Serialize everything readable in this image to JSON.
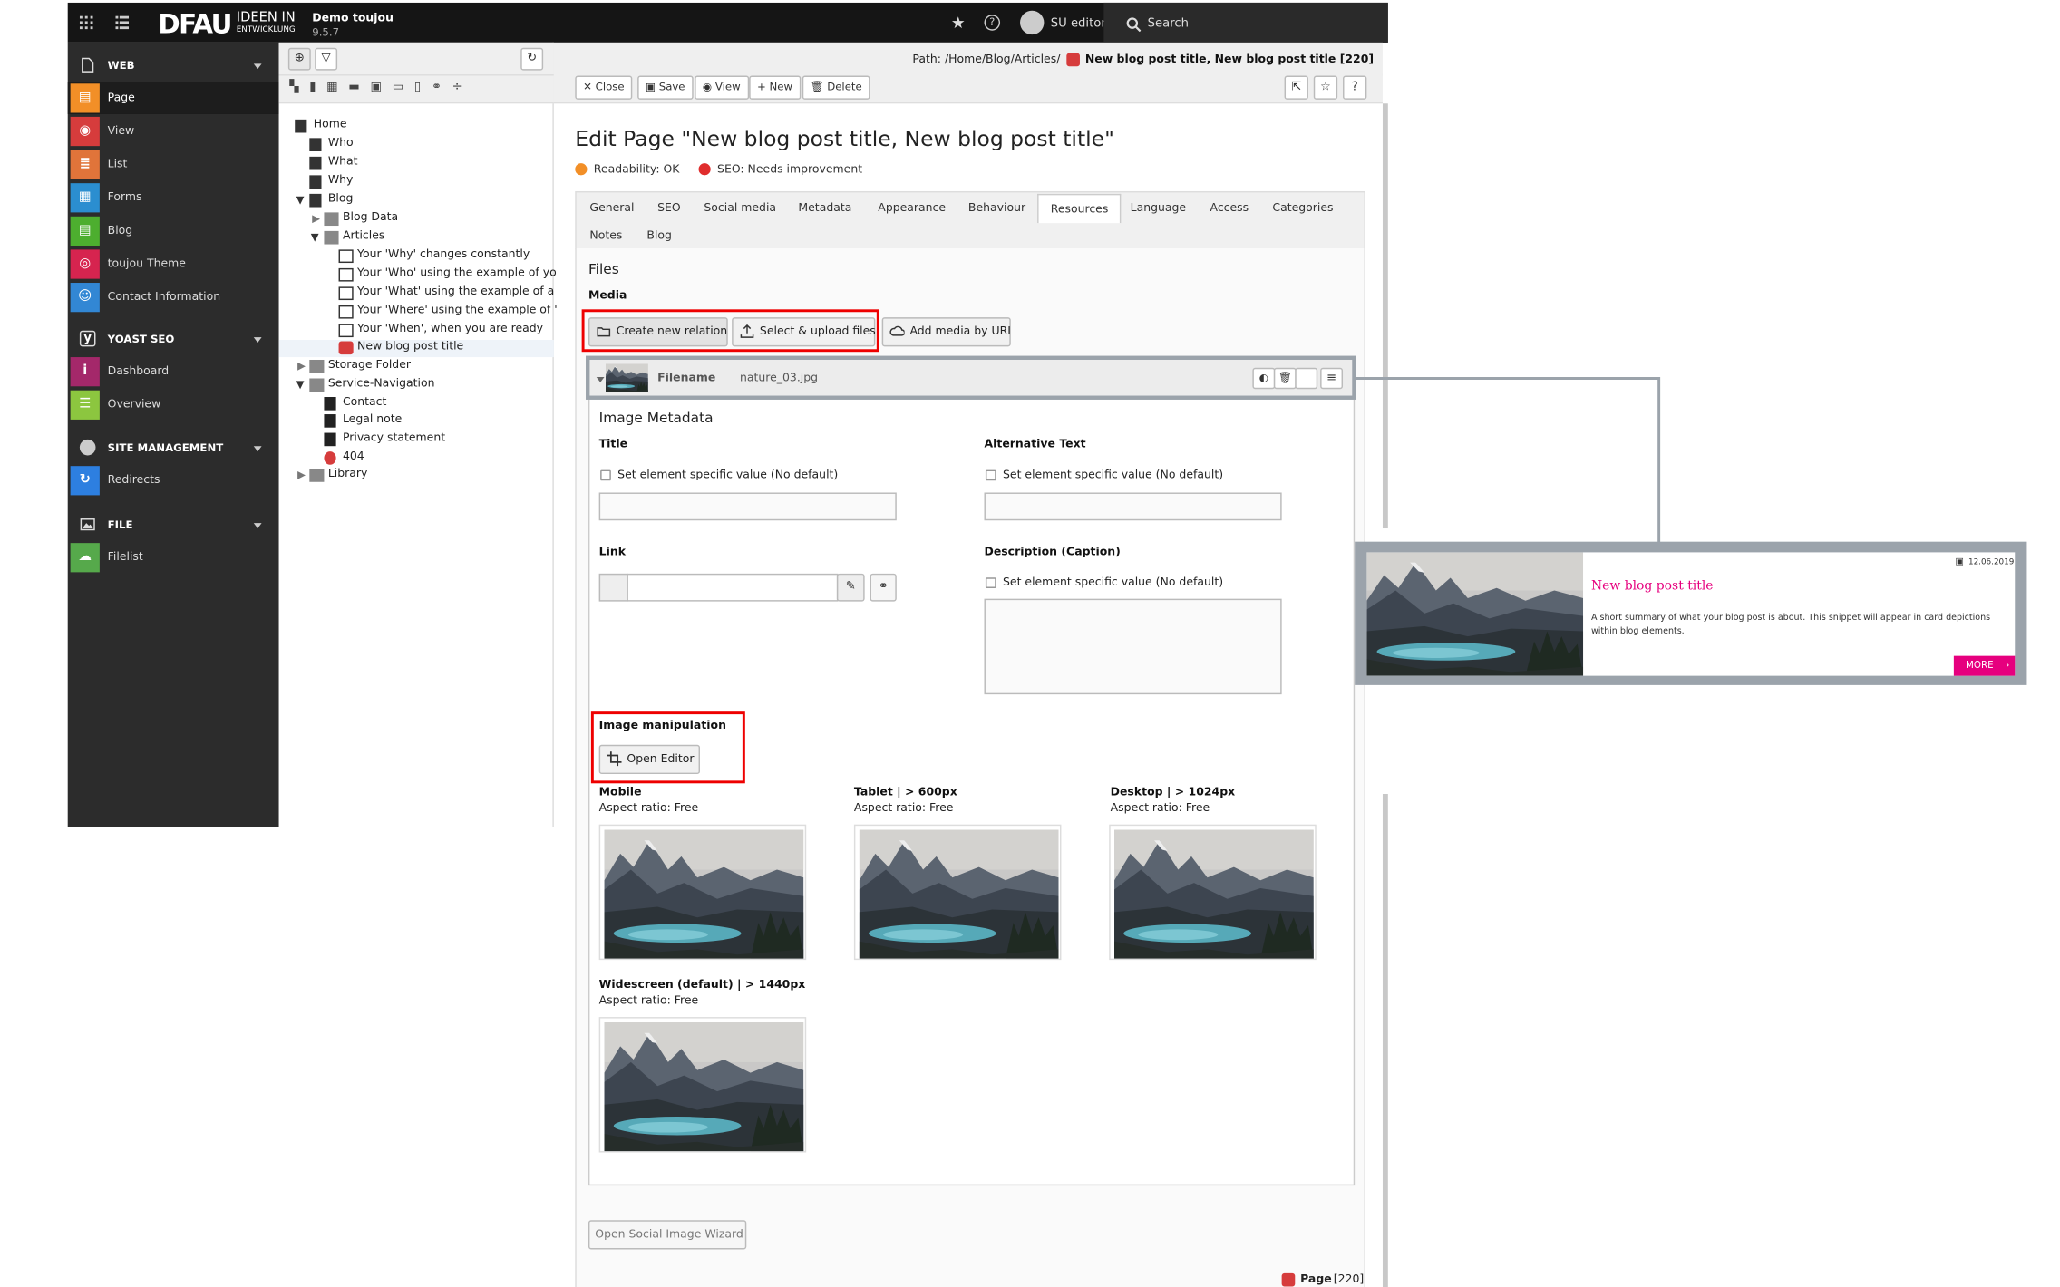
{
  "topbar": {
    "brand_main": "DFAU",
    "brand_sub_top": "IDEEN IN",
    "brand_sub_bottom": "ENTWICKLUNG",
    "site_name": "Demo toujou",
    "version": "9.5.7",
    "user": "SU editor",
    "search": "Search"
  },
  "modules": {
    "web": {
      "label": "WEB",
      "items": [
        "Page",
        "View",
        "List",
        "Forms",
        "Blog",
        "toujou Theme",
        "Contact Information"
      ]
    },
    "yoast": {
      "label": "YOAST SEO",
      "items": [
        "Dashboard",
        "Overview"
      ]
    },
    "site": {
      "label": "SITE MANAGEMENT",
      "items": [
        "Redirects"
      ]
    },
    "file": {
      "label": "FILE",
      "items": [
        "Filelist"
      ]
    },
    "colors": {
      "page": "#f28f27",
      "view": "#d63c3c",
      "list": "#e0743a",
      "forms": "#2b8ed0",
      "blog": "#4dae2f",
      "theme": "#d6244f",
      "contact": "#3287d4",
      "dashboard": "#a4286a",
      "overview": "#8cc63f",
      "redirects": "#2d7fe0",
      "filelist": "#56a94b"
    }
  },
  "tree": {
    "items": [
      "Home",
      "Who",
      "What",
      "Why",
      "Blog",
      "Blog Data",
      "Articles",
      "Your 'Why' changes constantly",
      "Your 'Who' using the example of yo",
      "Your 'What' using the example of a",
      "Your 'Where' using the example of '",
      "Your 'When', when you are ready",
      "New blog post title",
      "Storage Folder",
      "Service-Navigation",
      "Contact",
      "Legal note",
      "Privacy statement",
      "404",
      "Library"
    ]
  },
  "doc": {
    "path_label": "Path: /Home/Blog/Articles/",
    "path_page": "New blog post title, New blog post title [220]",
    "buttons": {
      "close": "Close",
      "save": "Save",
      "view": "View",
      "new": "New",
      "delete": "Delete"
    },
    "title": "Edit Page \"New blog post title, New blog post title\"",
    "readability": "Readability: OK",
    "seo": "SEO: Needs improvement",
    "tabs": [
      "General",
      "SEO",
      "Social media",
      "Metadata",
      "Appearance",
      "Behaviour",
      "Resources",
      "Language",
      "Access",
      "Categories",
      "Notes",
      "Blog"
    ],
    "files_heading": "Files",
    "media_label": "Media",
    "create_relation": "Create new relation",
    "select_upload": "Select & upload files",
    "add_url": "Add media by URL",
    "file_header_label": "Filename",
    "file_name": "nature_03.jpg",
    "image_metadata": "Image Metadata",
    "title_label": "Title",
    "alt_label": "Alternative Text",
    "set_specific": "Set element specific value (No default)",
    "link_label": "Link",
    "desc_label": "Description (Caption)",
    "image_manipulation": "Image manipulation",
    "open_editor": "Open Editor",
    "crops": [
      {
        "name": "Mobile",
        "ratio": "Aspect ratio: Free"
      },
      {
        "name": "Tablet | > 600px",
        "ratio": "Aspect ratio: Free"
      },
      {
        "name": "Desktop | > 1024px",
        "ratio": "Aspect ratio: Free"
      },
      {
        "name": "Widescreen (default) | > 1440px",
        "ratio": "Aspect ratio: Free"
      }
    ],
    "social_wizard": "Open Social Image Wizard",
    "footer_label": "Page",
    "footer_id": "[220]"
  },
  "card": {
    "date": "12.06.2019",
    "title": "New blog post title",
    "text": "A short summary of what your blog post is about. This snippet will appear in card depictions within blog elements.",
    "more": "MORE",
    "accent": "#e6007e"
  }
}
